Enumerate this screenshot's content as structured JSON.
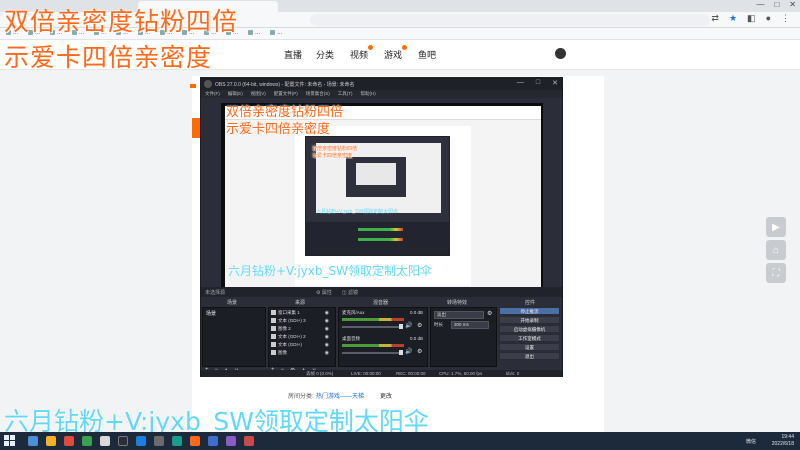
{
  "browser": {
    "bookmarks": [
      "...",
      "...",
      "...",
      "...",
      "...",
      "...",
      "...",
      "...",
      "...",
      "...",
      "...",
      "...",
      "..."
    ],
    "user": "",
    "download_label": ""
  },
  "site_nav": {
    "items": [
      "直播",
      "分类",
      "视频",
      "游戏",
      "鱼吧"
    ]
  },
  "obs": {
    "title": "OBS 27.0.0 (64-bit, windows) - 配置文件: 未命名 - 场景: 未命名",
    "menu": [
      "文件(F)",
      "编辑(E)",
      "视图(V)",
      "配置文件(P)",
      "场景集合(S)",
      "工具(T)",
      "帮助(H)"
    ],
    "no_source_label": "未选择源",
    "properties_label": "属性",
    "filters_label": "滤镜",
    "dock_titles": [
      "场景",
      "来源",
      "混音器",
      "转场特效",
      "控件"
    ],
    "scenes": [
      "场景"
    ],
    "sources": [
      "窗口采集 1",
      "文本 (GDI+) 3",
      "图像 2",
      "文本 (GDI+) 2",
      "文本 (GDI+)",
      "图像"
    ],
    "mixer": [
      {
        "name": "麦克风/Aux",
        "db": "0.0 dB"
      },
      {
        "name": "桌面音频",
        "db": "0.0 dB"
      }
    ],
    "transition": {
      "type_label": "淡出",
      "duration_label": "时长",
      "duration_value": "300 ms"
    },
    "controls": [
      "停止推流",
      "开始录制",
      "启动虚拟摄像机",
      "工作室模式",
      "设置",
      "退出"
    ],
    "status": {
      "dropped": "丢帧 0 (0.0%)",
      "live": "LIVE: 00:00:00",
      "rec": "REC: 00:00:00",
      "cpu": "CPU: 1.7%, 60.00 fps",
      "kbps": "kb/s: 0"
    }
  },
  "page_bottom": {
    "label": "房间分类:",
    "link": "热门游戏——天梯",
    "edit": "更改"
  },
  "promo": {
    "top_line1": "双倍亲密度钻粉四倍",
    "top_line2": "示爱卡四倍亲密度",
    "bottom": "六月钻粉+V:jyxb_SW领取定制太阳伞"
  },
  "taskbar": {
    "ime": "微信",
    "time": "19:44",
    "date": "2022/6/18"
  }
}
